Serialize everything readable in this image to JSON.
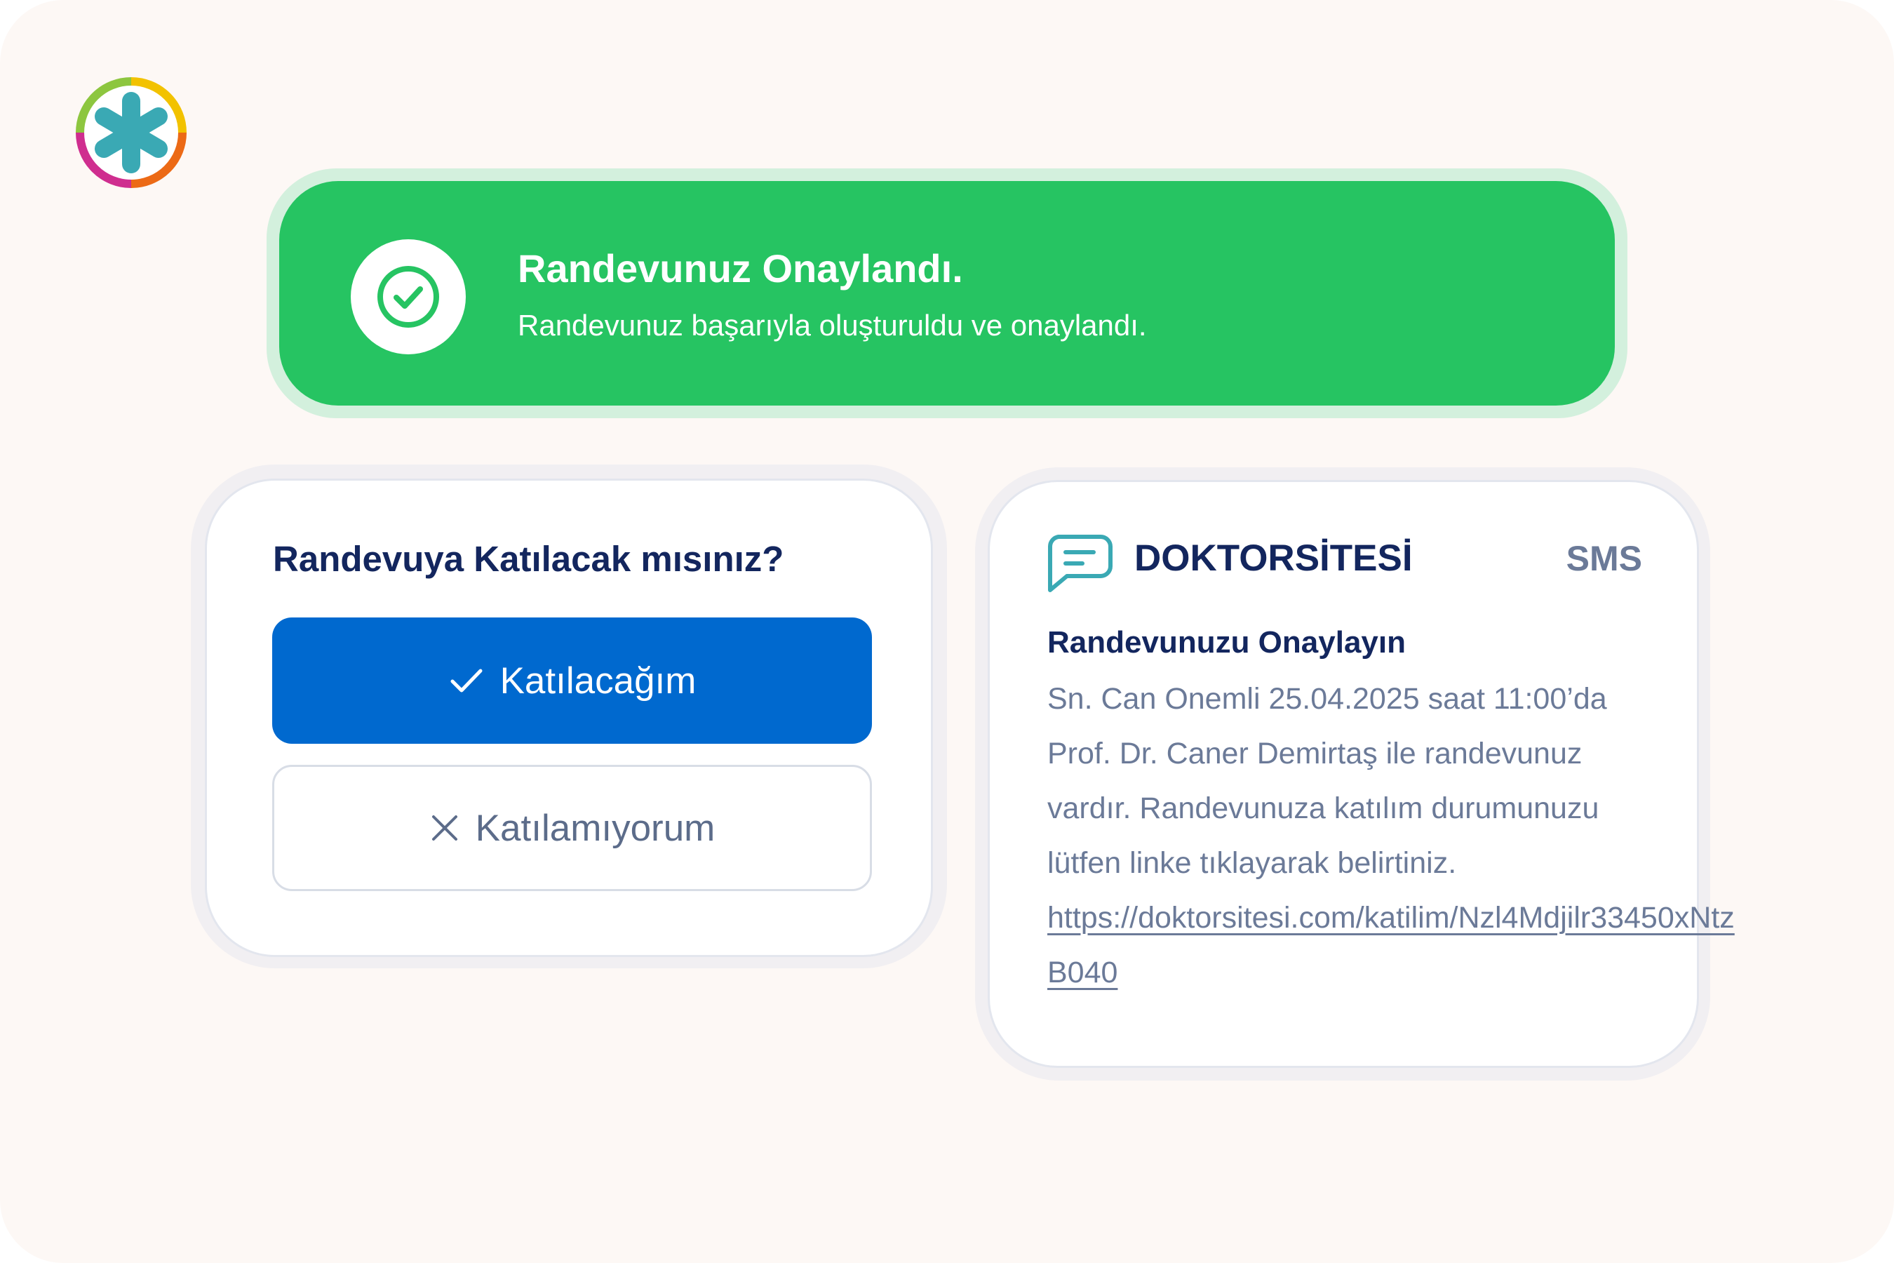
{
  "logo": {
    "icon": "asterisk-logo-icon"
  },
  "banner": {
    "icon": "check-circle-icon",
    "title": "Randevunuz Onaylandı.",
    "subtitle": "Randevunuz başarıyla oluşturuldu ve onaylandı.",
    "color": "#26c462"
  },
  "attendance": {
    "question": "Randevuya Katılacak mısınız?",
    "confirm_label": "Katılacağım",
    "confirm_icon": "check-icon",
    "decline_label": "Katılamıyorum",
    "decline_icon": "close-icon",
    "accent": "#0069cf"
  },
  "sms": {
    "icon": "chat-bubble-icon",
    "sender": "DOKTORSİTESİ",
    "tag": "SMS",
    "subject": "Randevunuzu Onaylayın",
    "message_text": "Sn. Can Onemli 25.04.2025 saat 11:00’da Prof. Dr. Caner Demirtaş ile randevunuz vardır. Randevunuza katılım durumunuzu lütfen linke tıklayarak belirtiniz.",
    "link_text": "https://doktorsitesi.com/katilim/Nzl4Mdjilr33450xNtz B040"
  }
}
